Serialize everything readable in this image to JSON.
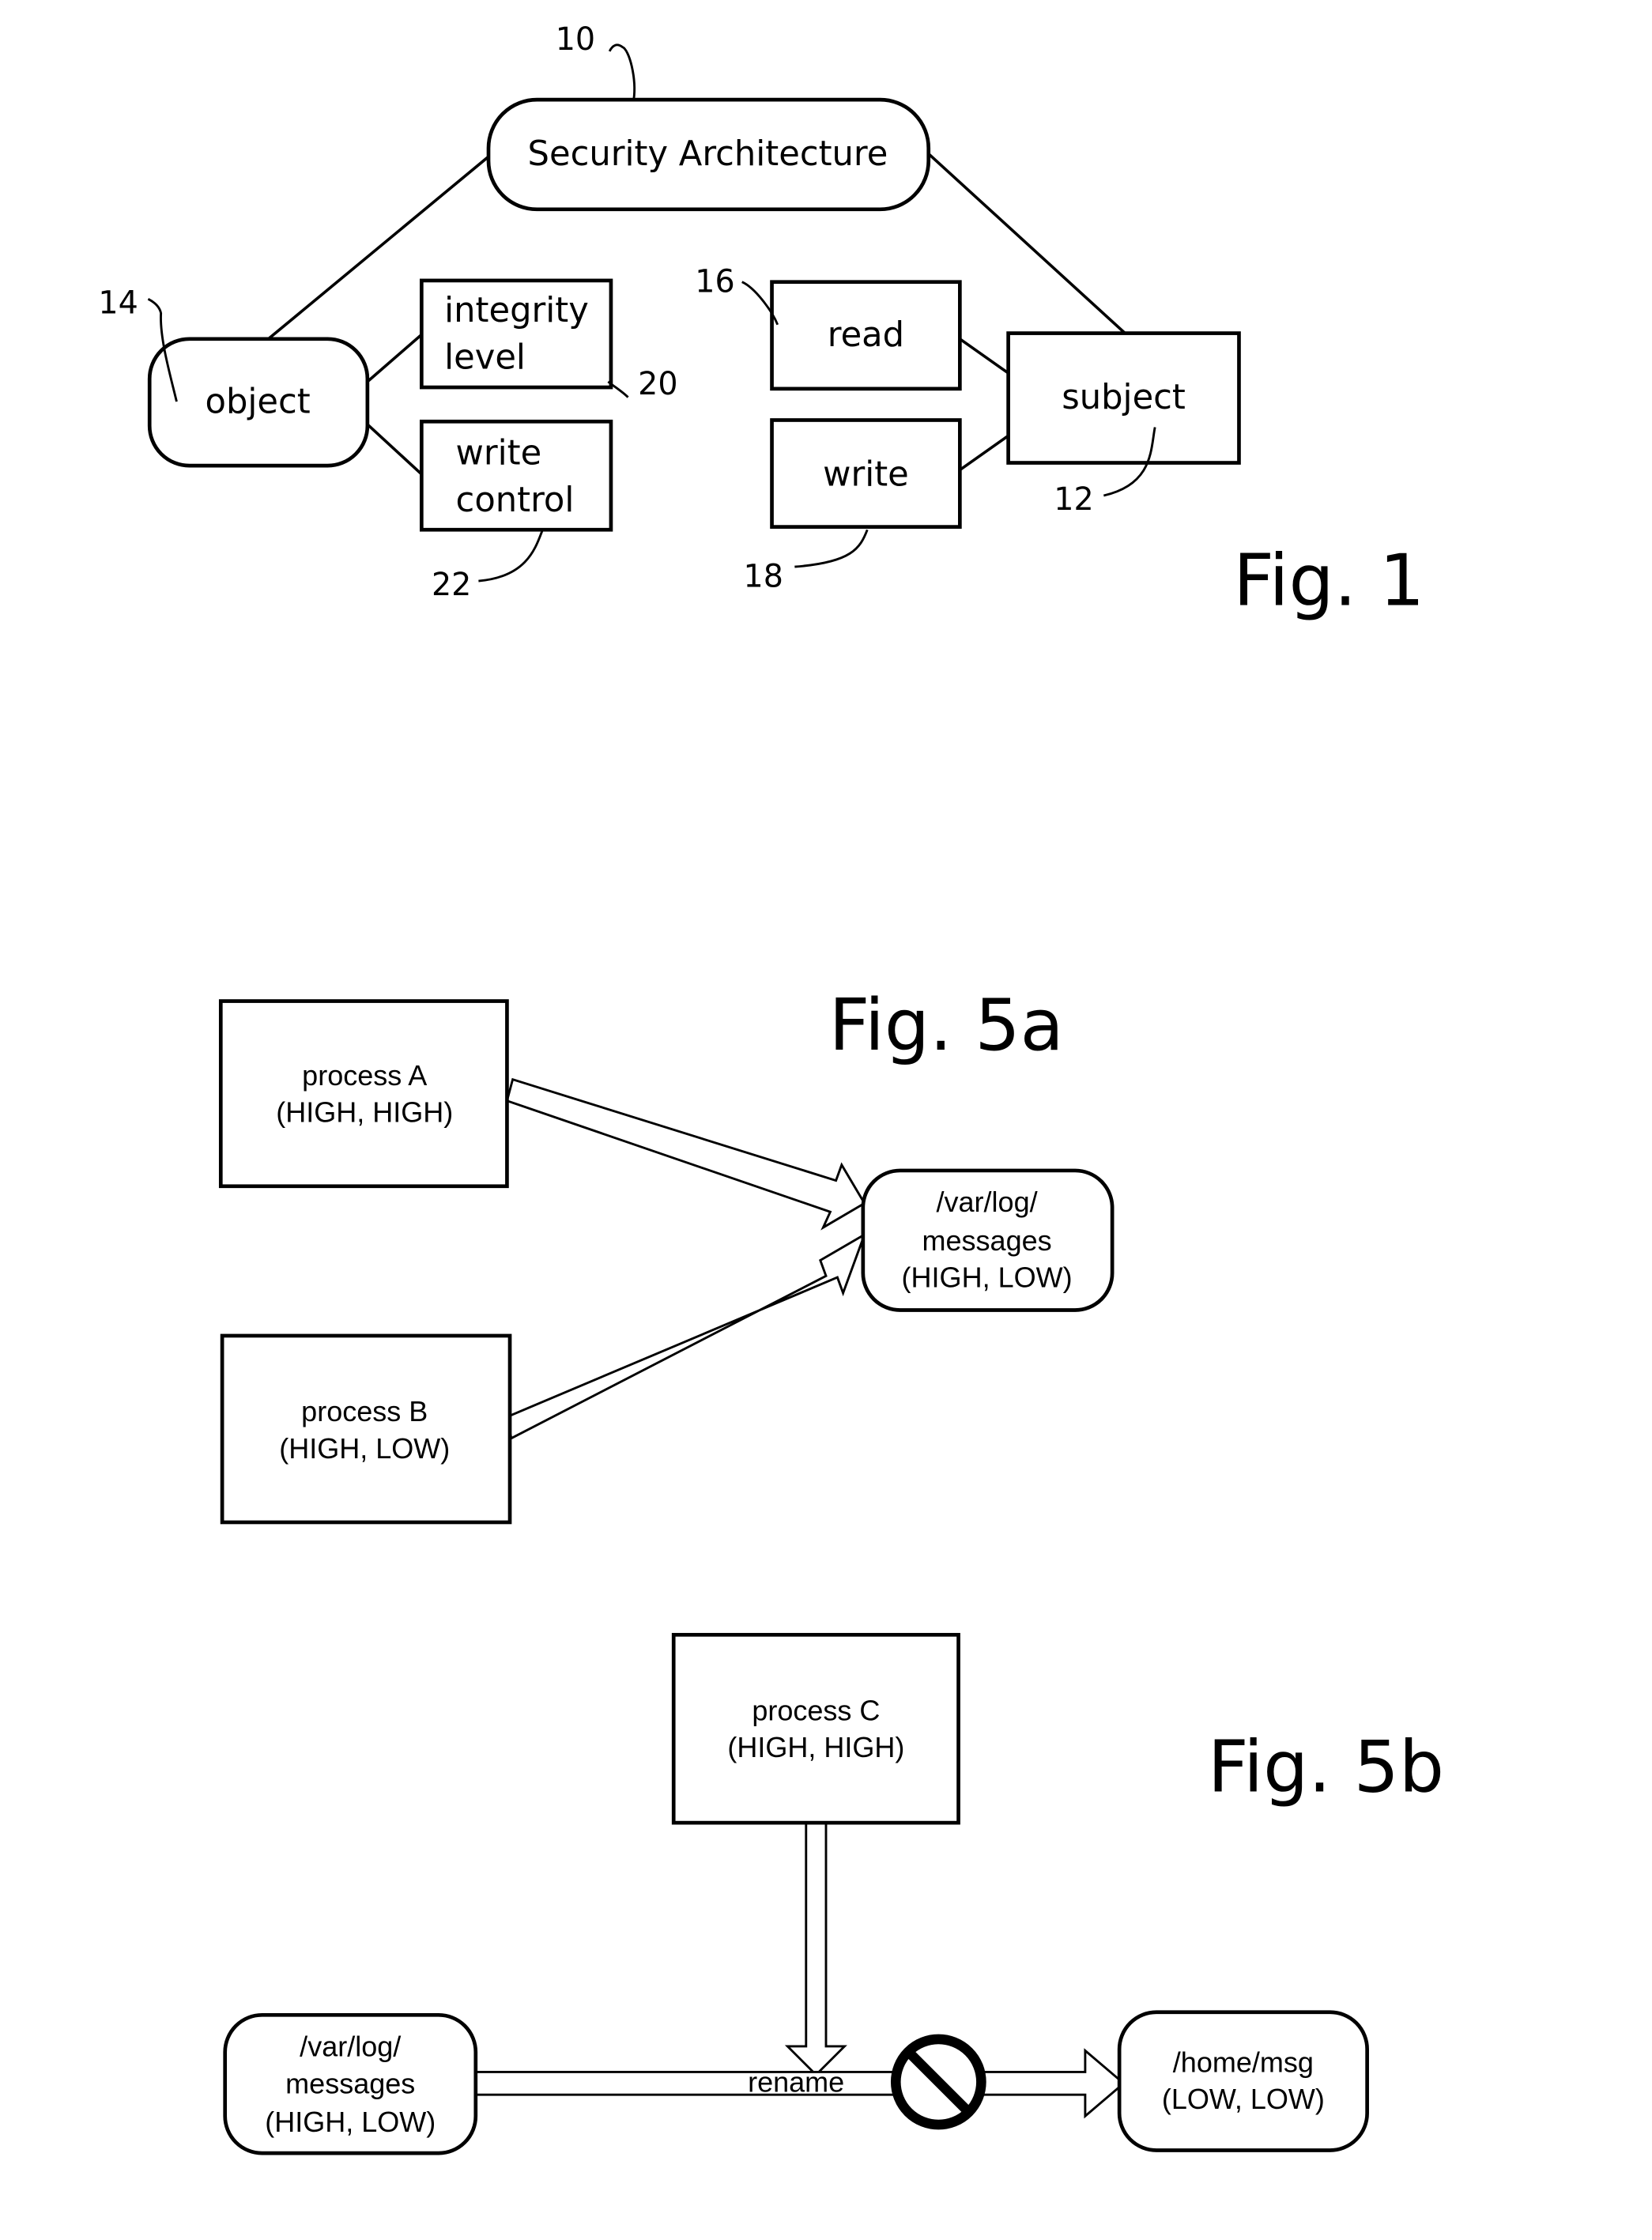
{
  "fig1": {
    "title": "Fig. 1",
    "nodes": {
      "security_architecture": {
        "label": "Security Architecture",
        "ref": "10"
      },
      "subject": {
        "label": "subject",
        "ref": "12"
      },
      "object": {
        "label": "object",
        "ref": "14"
      },
      "read": {
        "label": "read",
        "ref": "16"
      },
      "write": {
        "label": "write",
        "ref": "18"
      },
      "integrity_level": {
        "line1": "integrity",
        "line2": "level",
        "ref": "20"
      },
      "write_control": {
        "line1": "write",
        "line2": "control",
        "ref": "22"
      }
    }
  },
  "fig5a": {
    "title": "Fig. 5a",
    "process_a": {
      "line1": "process A",
      "line2": "(HIGH, HIGH)"
    },
    "process_b": {
      "line1": "process  B",
      "line2": "(HIGH, LOW)"
    },
    "file": {
      "line1": "/var/log/",
      "line2": "messages",
      "line3": "(HIGH, LOW)"
    }
  },
  "fig5b": {
    "title": "Fig. 5b",
    "process_c": {
      "line1": "process C",
      "line2": "(HIGH, HIGH)"
    },
    "source_file": {
      "line1": "/var/log/",
      "line2": "messages",
      "line3": "(HIGH, LOW)"
    },
    "target_file": {
      "line1": "/home/msg",
      "line2": "(LOW, LOW)"
    },
    "operation": "rename",
    "prohibited_icon": "no-entry-icon"
  }
}
